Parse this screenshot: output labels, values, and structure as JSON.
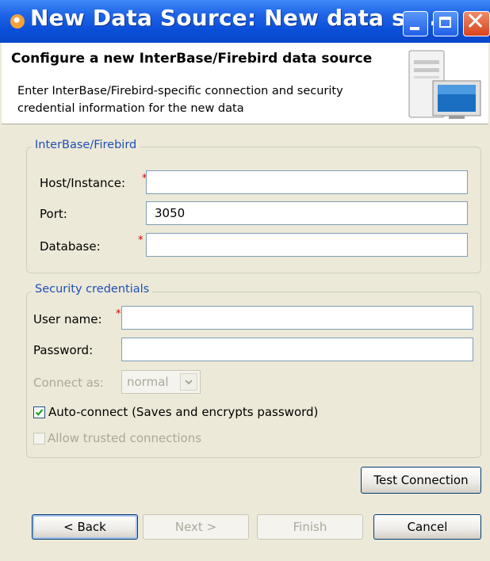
{
  "window": {
    "title": "New Data Source: New data so..."
  },
  "header": {
    "title": "Configure a new InterBase/Firebird data source",
    "description": "Enter InterBase/Firebird-specific connection and security credential information for the new data"
  },
  "connection_group": {
    "legend": "InterBase/Firebird",
    "host_label": "Host/Instance:",
    "host_value": "",
    "port_label": "Port:",
    "port_value": "3050",
    "database_label": "Database:",
    "database_value": "",
    "required_marker": "*"
  },
  "security_group": {
    "legend": "Security credentials",
    "username_label": "User name:",
    "username_value": "",
    "password_label": "Password:",
    "password_value": "",
    "connect_as_label": "Connect as:",
    "connect_as_value": "normal",
    "auto_connect_label": "Auto-connect (Saves and encrypts password)",
    "auto_connect_checked": true,
    "trusted_label": "Allow trusted connections",
    "trusted_checked": false
  },
  "buttons": {
    "test_connection": "Test Connection",
    "back": "< Back",
    "next": "Next >",
    "finish": "Finish",
    "cancel": "Cancel"
  }
}
